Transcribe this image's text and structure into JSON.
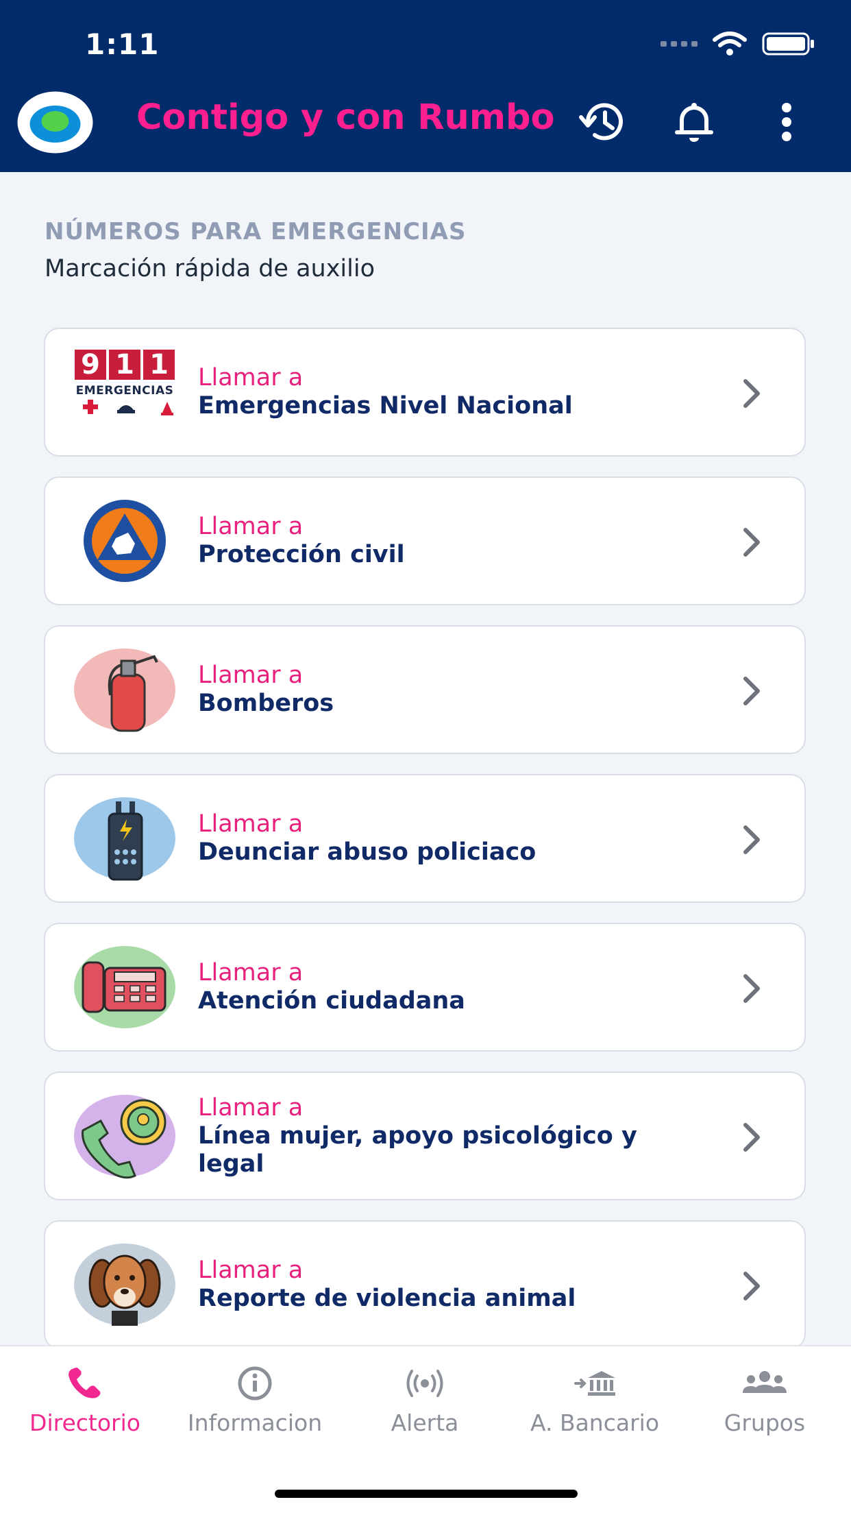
{
  "status_bar": {
    "time": "1:11"
  },
  "header": {
    "title": "Contigo y con Rumbo"
  },
  "section": {
    "kicker": "NÚMEROS PARA EMERGENCIAS",
    "subtitle": "Marcación rápida de auxilio"
  },
  "logo_911": {
    "digits": [
      "9",
      "1",
      "1"
    ],
    "caption": "EMERGENCIAS"
  },
  "contacts": [
    {
      "prefix": "Llamar a",
      "name": "Emergencias Nivel Nacional",
      "icon": "911-emergencias-icon"
    },
    {
      "prefix": "Llamar a",
      "name": "Protección civil",
      "icon": "proteccion-civil-seal-icon"
    },
    {
      "prefix": "Llamar a",
      "name": "Bomberos",
      "icon": "fire-extinguisher-icon"
    },
    {
      "prefix": "Llamar a",
      "name": "Deunciar abuso policiaco",
      "icon": "police-radio-icon"
    },
    {
      "prefix": "Llamar a",
      "name": "Atención ciudadana",
      "icon": "telephone-icon"
    },
    {
      "prefix": "Llamar a",
      "name": "Línea mujer, apoyo psicológico y legal",
      "icon": "woman-phone-icon"
    },
    {
      "prefix": "Llamar a",
      "name": "Reporte de violencia animal",
      "icon": "dog-icon"
    }
  ],
  "tabs": [
    {
      "label": "Directorio",
      "icon": "phone-icon",
      "active": true
    },
    {
      "label": "Informacion",
      "icon": "info-icon",
      "active": false
    },
    {
      "label": "Alerta",
      "icon": "broadcast-icon",
      "active": false
    },
    {
      "label": "A. Bancario",
      "icon": "bank-icon",
      "active": false
    },
    {
      "label": "Grupos",
      "icon": "group-icon",
      "active": false
    }
  ],
  "colors": {
    "header_bg": "#022b6b",
    "accent_pink": "#ff1f8e",
    "title_navy": "#0f2a66"
  }
}
